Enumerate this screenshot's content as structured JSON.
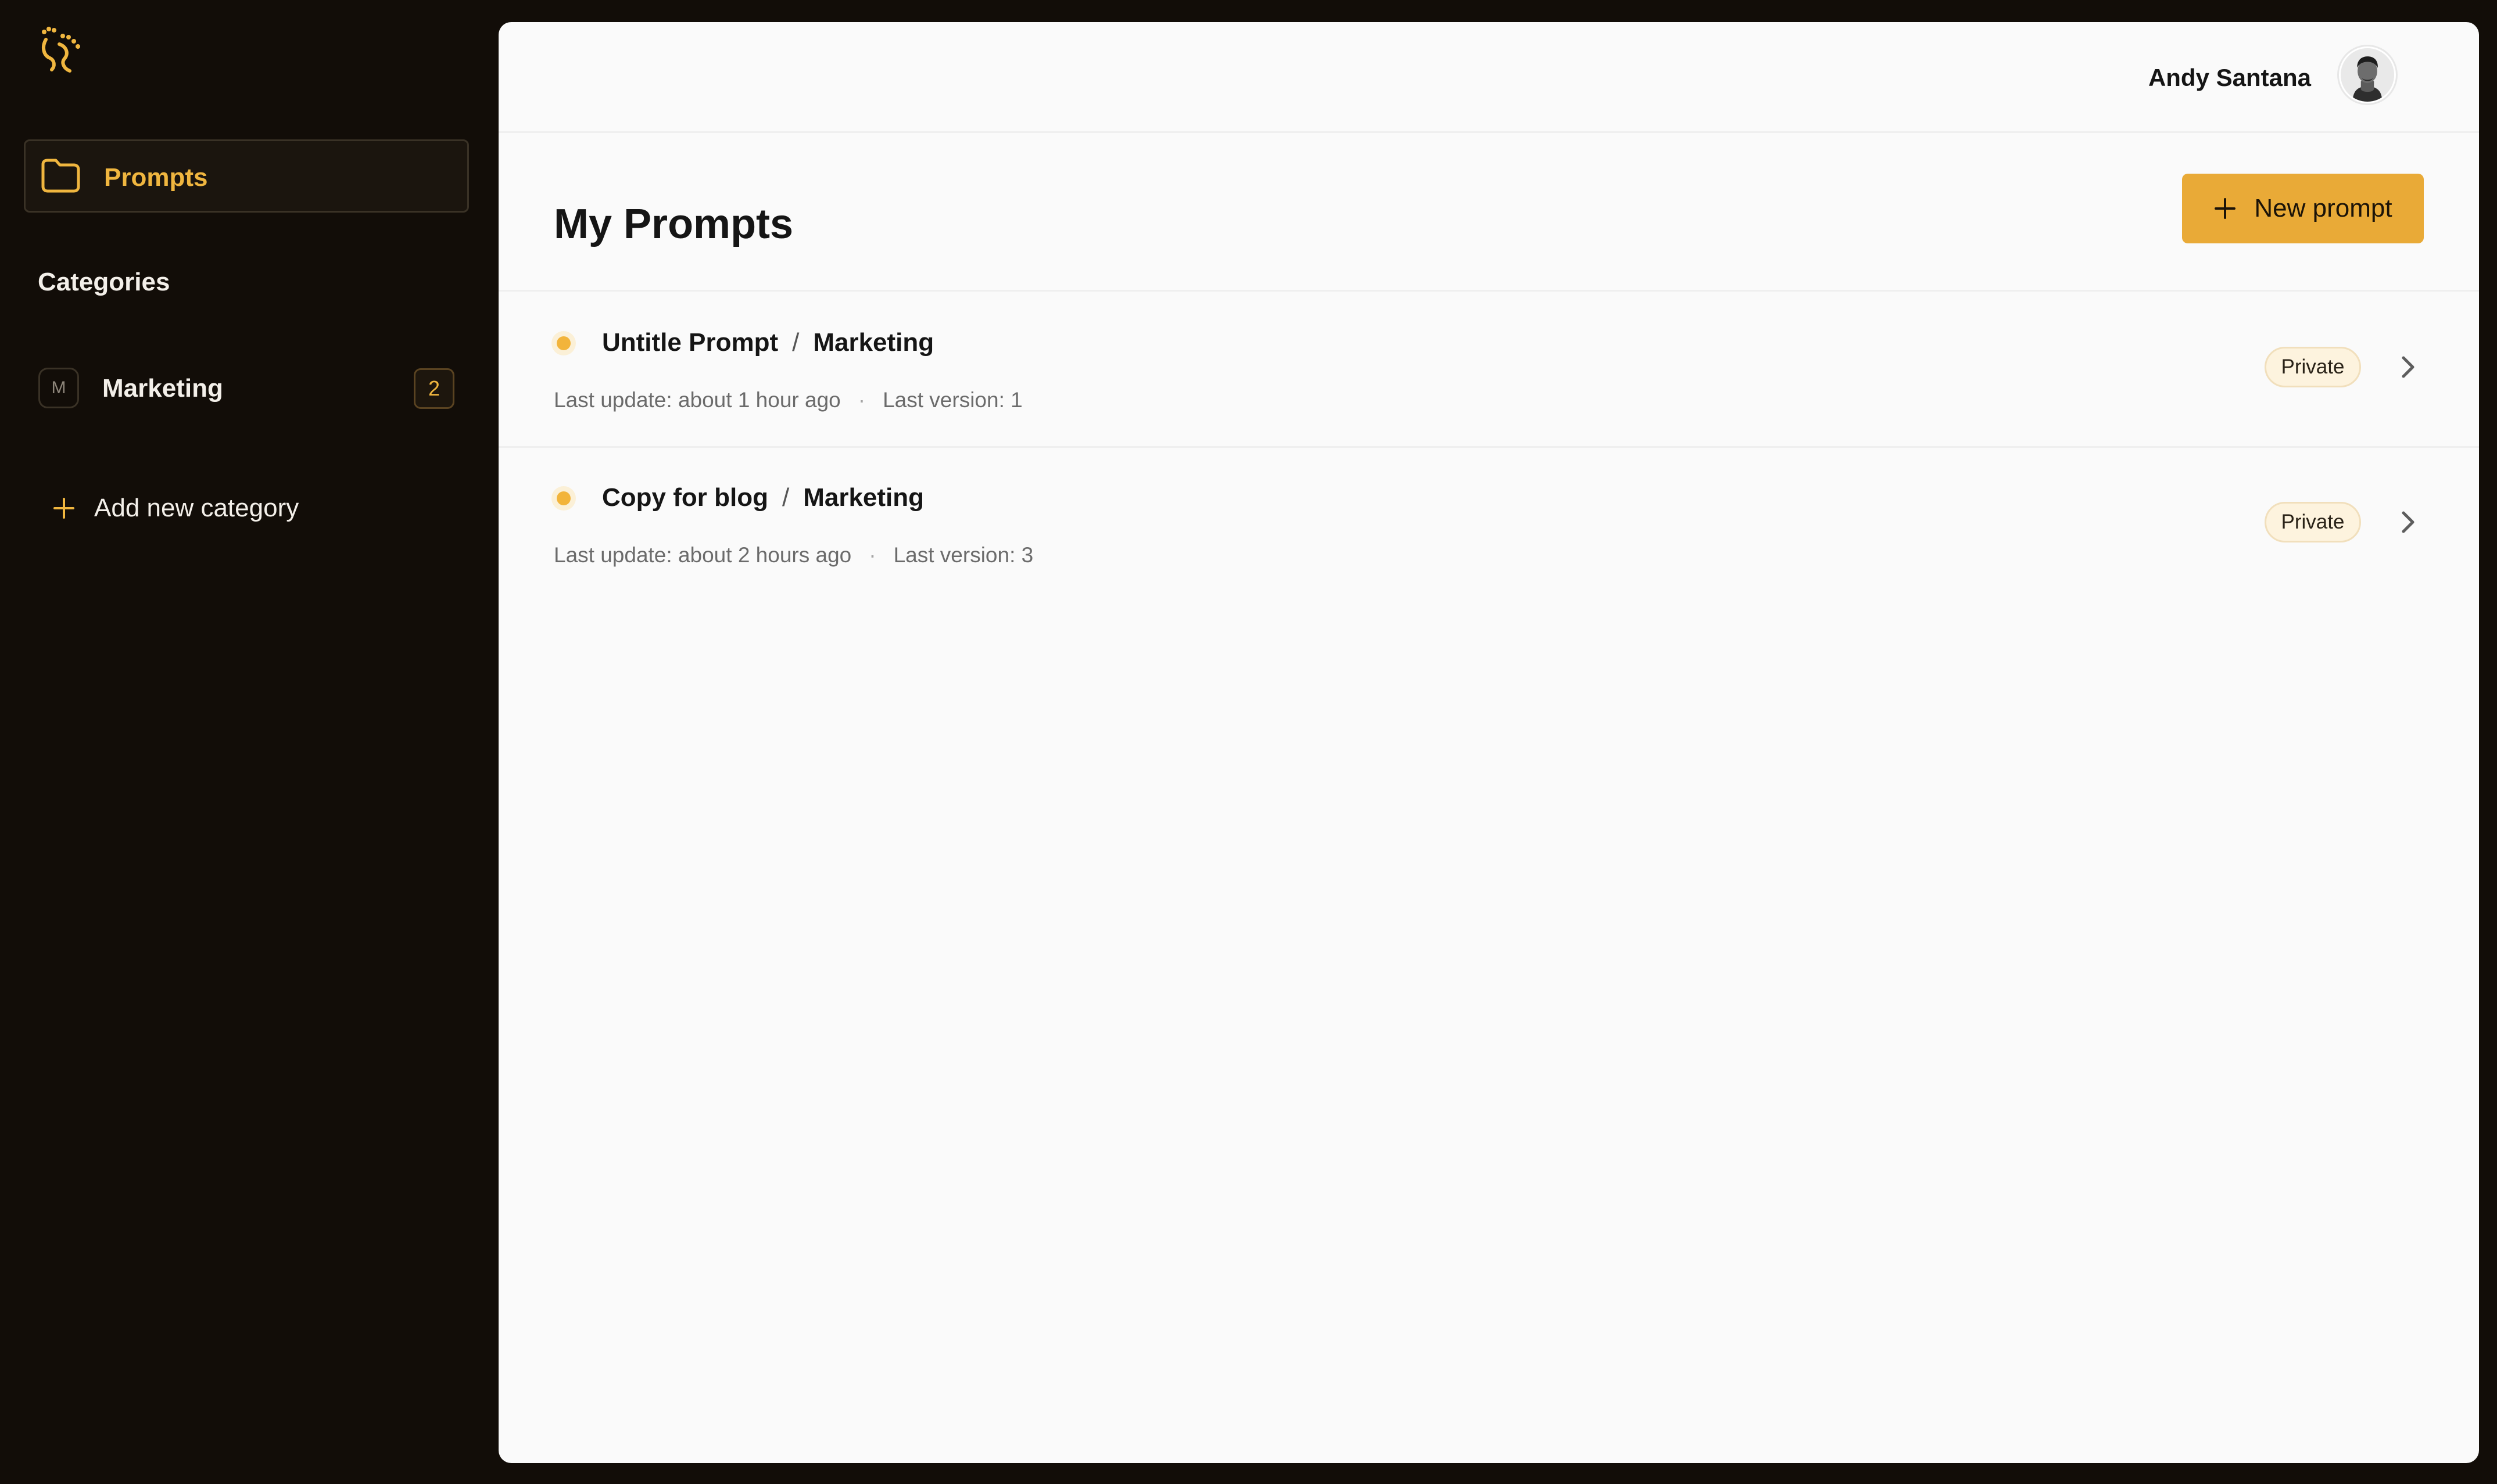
{
  "sidebar": {
    "logo_icon": "feet-logo-icon",
    "nav_prompts_label": "Prompts",
    "categories_heading": "Categories",
    "categories": [
      {
        "initial": "M",
        "name": "Marketing",
        "count": "2"
      }
    ],
    "add_category_label": "Add new category"
  },
  "header": {
    "user_name": "Andy Santana"
  },
  "main": {
    "title": "My Prompts",
    "new_prompt_label": "New prompt",
    "prompts": [
      {
        "title": "Untitle Prompt",
        "category": "Marketing",
        "last_update": "Last update: about 1 hour ago",
        "last_version": "Last version: 1",
        "visibility": "Private"
      },
      {
        "title": "Copy for blog",
        "category": "Marketing",
        "last_update": "Last update: about 2 hours ago",
        "last_version": "Last version: 3",
        "visibility": "Private"
      }
    ]
  },
  "colors": {
    "sidebar_bg": "#120d08",
    "accent": "#e9aa37",
    "main_bg": "#fafafa"
  }
}
